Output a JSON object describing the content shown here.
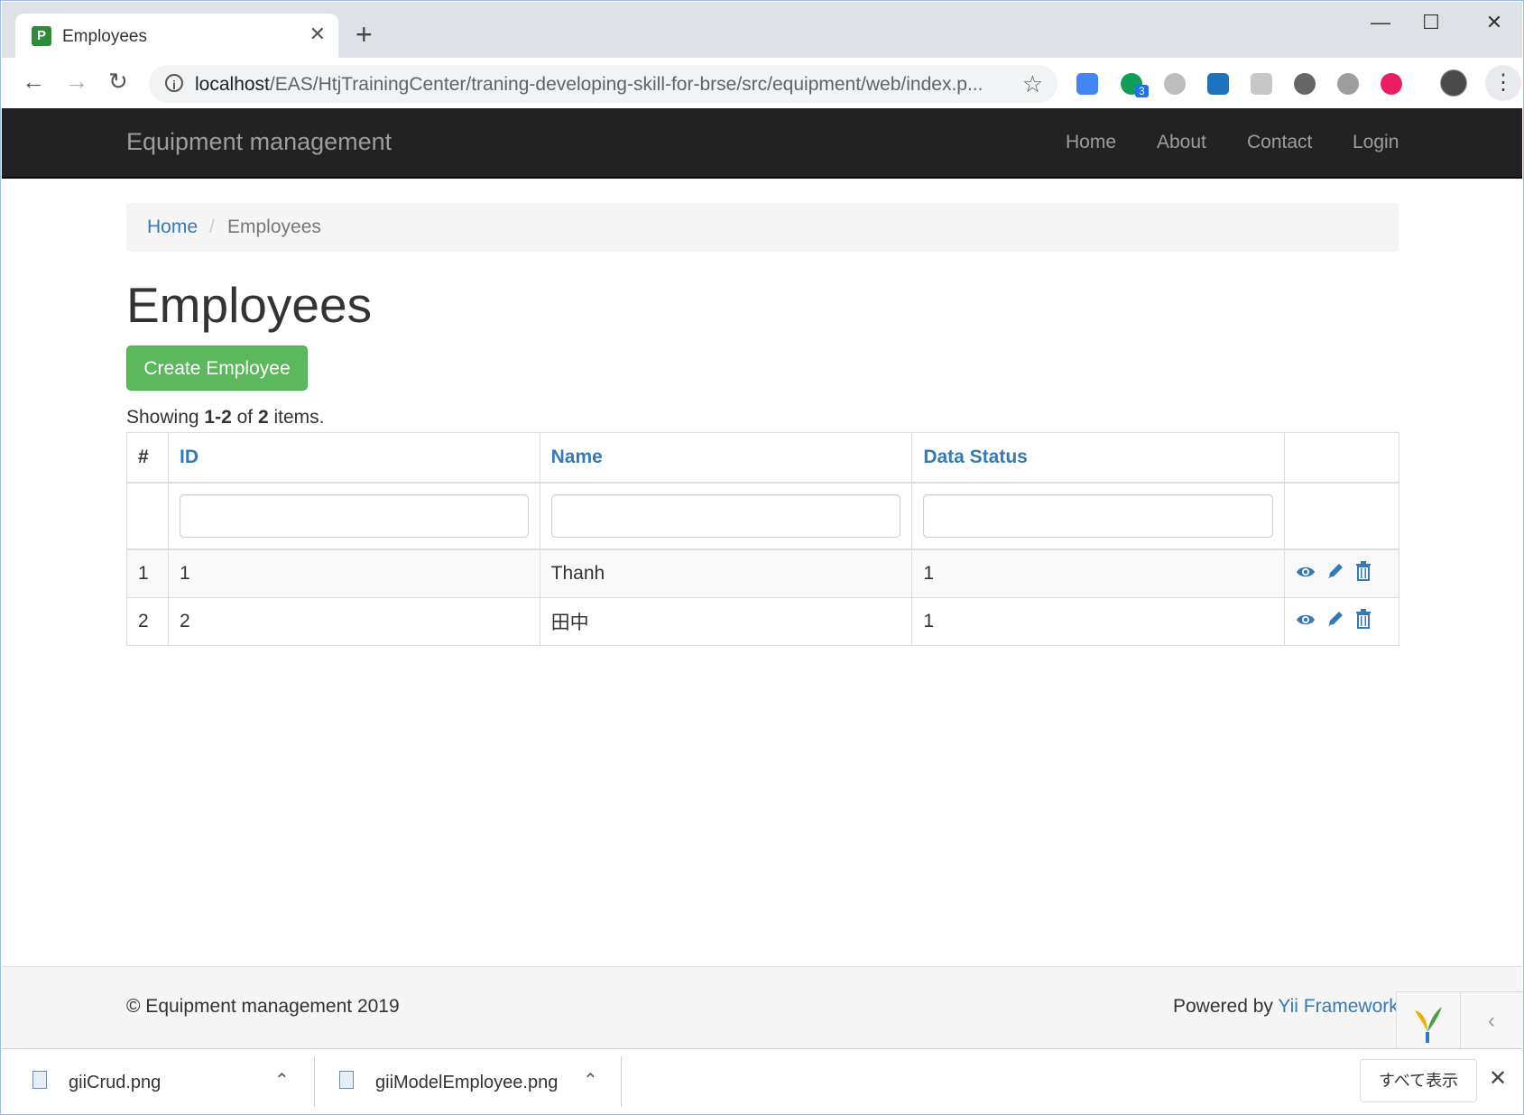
{
  "browser": {
    "tab_title": "Employees",
    "tab_favicon": "P",
    "tab_close": "✕",
    "new_tab": "+",
    "url_host": "localhost",
    "url_path": "/EAS/HtjTrainingCenter/traning-developing-skill-for-brse/src/equipment/web/index.p...",
    "extension_badge": "3",
    "window_controls": {
      "minimize": "—",
      "maximize": "☐",
      "close": "✕"
    }
  },
  "navbar": {
    "brand": "Equipment management",
    "links": [
      "Home",
      "About",
      "Contact",
      "Login"
    ]
  },
  "breadcrumb": {
    "home": "Home",
    "separator": "/",
    "current": "Employees"
  },
  "page": {
    "title": "Employees",
    "create_button": "Create Employee",
    "summary": {
      "prefix": "Showing ",
      "range": "1-2",
      "mid": " of ",
      "total": "2",
      "suffix": " items."
    }
  },
  "grid": {
    "headers": {
      "serial": "#",
      "id": "ID",
      "name": "Name",
      "status": "Data Status"
    },
    "filters": {
      "id": "",
      "name": "",
      "status": ""
    },
    "rows": [
      {
        "serial": "1",
        "id": "1",
        "name": "Thanh",
        "status": "1"
      },
      {
        "serial": "2",
        "id": "2",
        "name": "田中",
        "status": "1"
      }
    ]
  },
  "footer": {
    "copyright": "© Equipment management 2019",
    "powered_prefix": "Powered by ",
    "powered_link": "Yii Framework"
  },
  "downloads": {
    "items": [
      "giiCrud.png",
      "giiModelEmployee.png"
    ],
    "show_all": "すべて表示",
    "close": "✕"
  },
  "colors": {
    "navbar_bg": "#222222",
    "link": "#337ab7",
    "create_button": "#5cb85c",
    "tab_strip": "#dee1e6"
  }
}
